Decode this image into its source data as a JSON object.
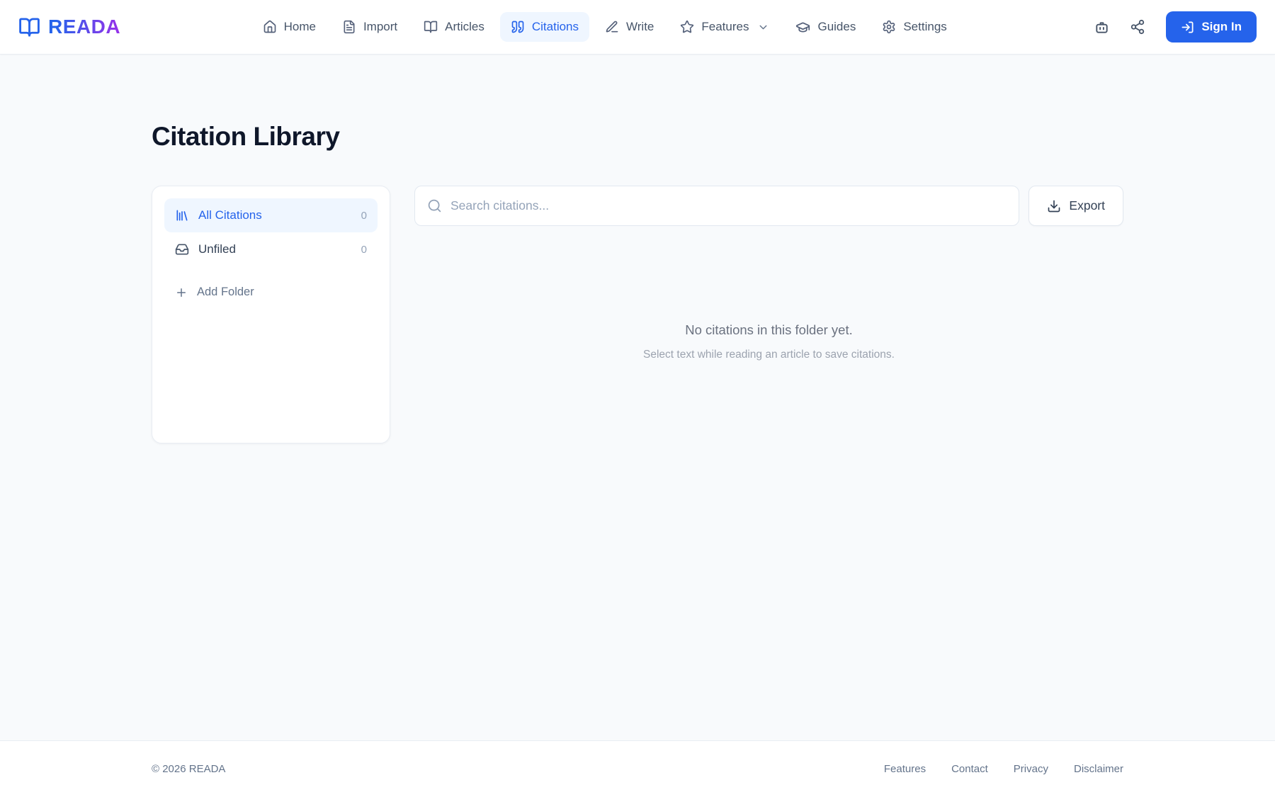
{
  "brand": {
    "name": "READA"
  },
  "nav": {
    "items": [
      {
        "label": "Home",
        "icon": "house-icon",
        "active": false
      },
      {
        "label": "Import",
        "icon": "file-text-icon",
        "active": false
      },
      {
        "label": "Articles",
        "icon": "book-open-icon",
        "active": false
      },
      {
        "label": "Citations",
        "icon": "quote-icon",
        "active": true
      },
      {
        "label": "Write",
        "icon": "pen-icon",
        "active": false
      },
      {
        "label": "Features",
        "icon": "star-icon",
        "active": false,
        "has_dropdown": true
      },
      {
        "label": "Guides",
        "icon": "graduation-cap-icon",
        "active": false
      },
      {
        "label": "Settings",
        "icon": "gear-icon",
        "active": false
      }
    ],
    "sign_in_label": "Sign In"
  },
  "page": {
    "title": "Citation Library"
  },
  "sidebar": {
    "folders": [
      {
        "label": "All Citations",
        "count": "0",
        "icon": "library-icon",
        "active": true
      },
      {
        "label": "Unfiled",
        "count": "0",
        "icon": "inbox-icon",
        "active": false
      }
    ],
    "add_folder_label": "Add Folder"
  },
  "toolbar": {
    "search_placeholder": "Search citations...",
    "export_label": "Export"
  },
  "empty_state": {
    "title": "No citations in this folder yet.",
    "subtitle": "Select text while reading an article to save citations."
  },
  "footer": {
    "copyright": "© 2026 READA",
    "links": [
      "Features",
      "Contact",
      "Privacy",
      "Disclaimer"
    ]
  },
  "colors": {
    "accent": "#2563eb",
    "accent_light": "#eff6ff",
    "logo_gradient_start": "#2563eb",
    "logo_gradient_end": "#9333ea",
    "background": "#f8fafc"
  }
}
